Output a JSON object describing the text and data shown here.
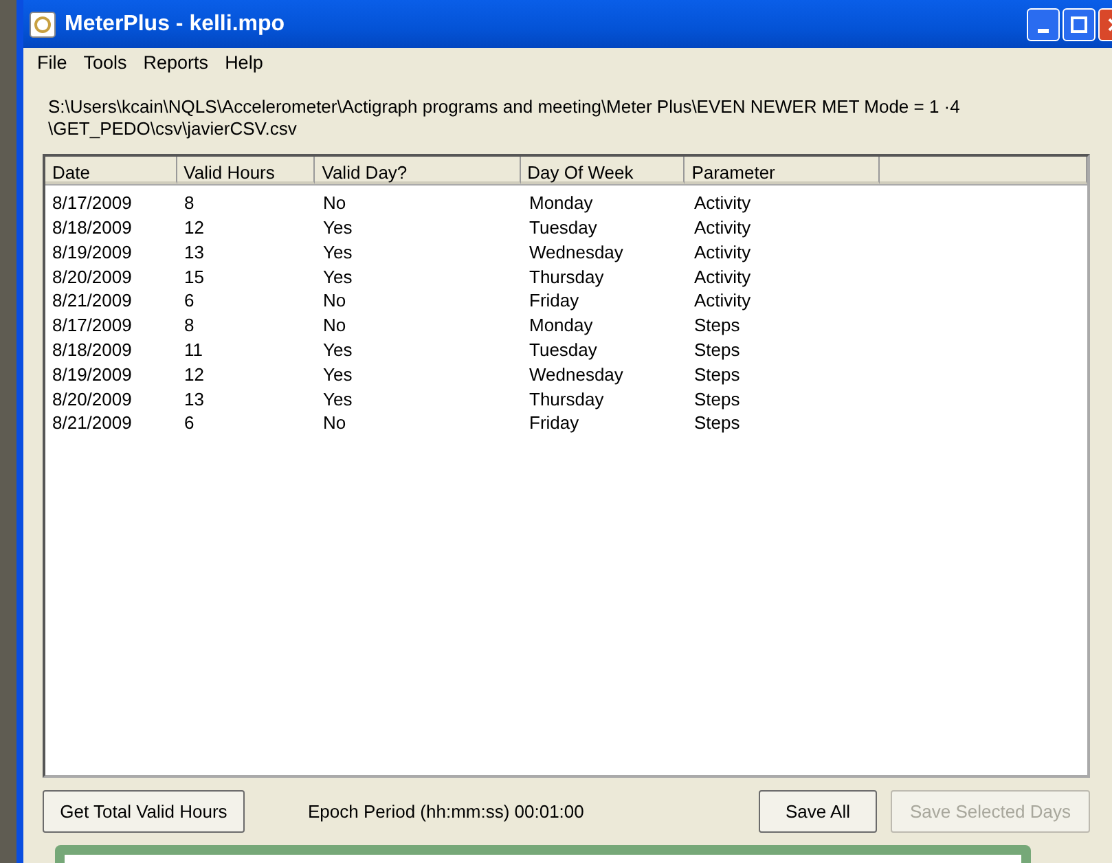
{
  "window": {
    "title": "MeterPlus - kelli.mpo"
  },
  "menu": [
    "File",
    "Tools",
    "Reports",
    "Help"
  ],
  "file_path": [
    "S:\\Users\\kcain\\NQLS\\Accelerometer\\Actigraph programs  and meeting\\Meter Plus\\EVEN  NEWER MET Mode = 1 ·4",
    "\\GET_PEDO\\csv\\javierCSV.csv"
  ],
  "table": {
    "columns": [
      "Date",
      "Valid Hours",
      "Valid Day?",
      "Day Of Week",
      "Parameter"
    ],
    "rows": [
      [
        "8/17/2009",
        "8",
        "No",
        "Monday",
        "Activity"
      ],
      [
        "8/18/2009",
        "12",
        "Yes",
        "Tuesday",
        "Activity"
      ],
      [
        "8/19/2009",
        "13",
        "Yes",
        "Wednesday",
        "Activity"
      ],
      [
        "8/20/2009",
        "15",
        "Yes",
        "Thursday",
        "Activity"
      ],
      [
        "8/21/2009",
        "6",
        "No",
        "Friday",
        "Activity"
      ],
      [
        "8/17/2009",
        "8",
        "No",
        "Monday",
        "Steps"
      ],
      [
        "8/18/2009",
        "11",
        "Yes",
        "Tuesday",
        "Steps"
      ],
      [
        "8/19/2009",
        "12",
        "Yes",
        "Wednesday",
        "Steps"
      ],
      [
        "8/20/2009",
        "13",
        "Yes",
        "Thursday",
        "Steps"
      ],
      [
        "8/21/2009",
        "6",
        "No",
        "Friday",
        "Steps"
      ]
    ]
  },
  "footer": {
    "left_button": {
      "label": "Get Total Valid Hours",
      "disabled": false
    },
    "epoch": "Epoch Period (hh:mm:ss) 00:01:00",
    "right_buttons": [
      {
        "label": "Save All",
        "disabled": false
      },
      {
        "label": "Save Selected Days",
        "disabled": true
      }
    ]
  }
}
